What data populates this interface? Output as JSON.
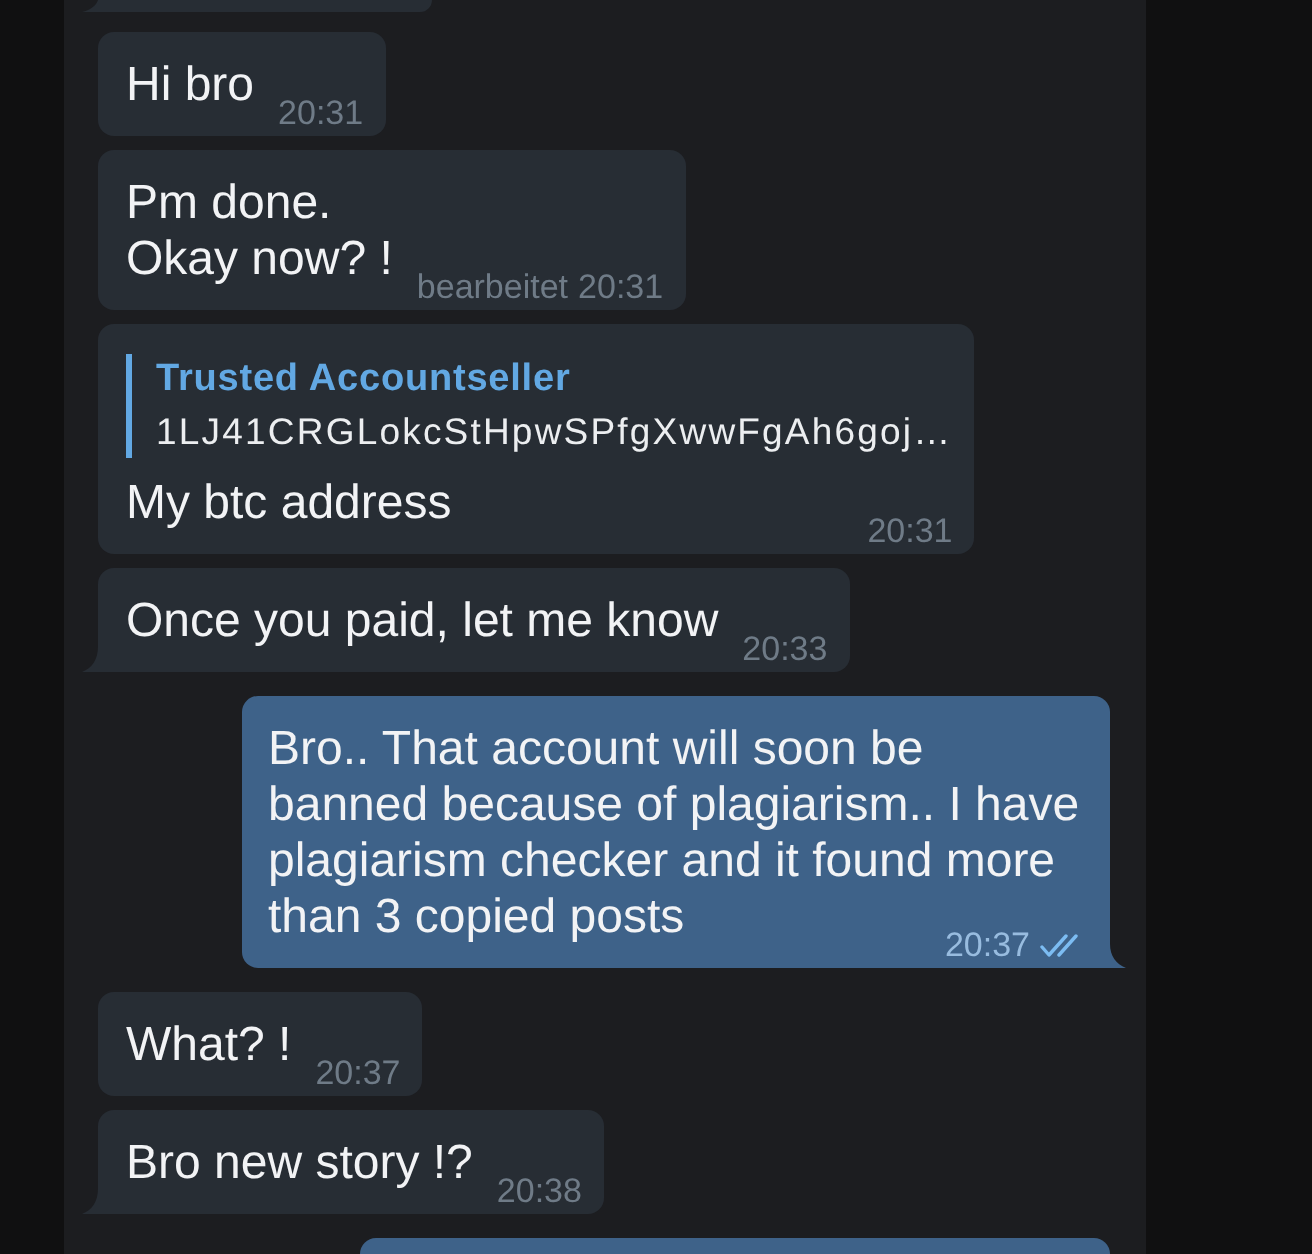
{
  "messages": [
    {
      "kind": "clipped",
      "outgoing": false,
      "tail": true
    },
    {
      "kind": "text",
      "outgoing": false,
      "tail": false,
      "text": "Hi bro",
      "time": "20:31"
    },
    {
      "kind": "text",
      "outgoing": false,
      "tail": false,
      "text": "Pm done.\nOkay now? !",
      "edited_label": "bearbeitet",
      "time": "20:31"
    },
    {
      "kind": "reply",
      "outgoing": false,
      "tail": false,
      "reply": {
        "author": "Trusted Accountseller",
        "text": "1LJ41CRGLokcStHpwSPfgXwwFgAh6goj…"
      },
      "text": "My btc address",
      "time": "20:31"
    },
    {
      "kind": "text",
      "outgoing": false,
      "tail": true,
      "text": "Once you paid, let me know",
      "time": "20:33"
    },
    {
      "kind": "text",
      "outgoing": true,
      "tail": true,
      "text": "Bro.. That account will soon be banned because of plagiarism.. I have plagiarism checker and it found more than 3 copied posts",
      "time": "20:37",
      "read": true
    },
    {
      "kind": "text",
      "outgoing": false,
      "tail": false,
      "text": "What? !",
      "time": "20:37"
    },
    {
      "kind": "text",
      "outgoing": false,
      "tail": true,
      "text": "Bro new story !?",
      "time": "20:38"
    },
    {
      "kind": "clipped",
      "outgoing": true,
      "tail": false
    }
  ]
}
